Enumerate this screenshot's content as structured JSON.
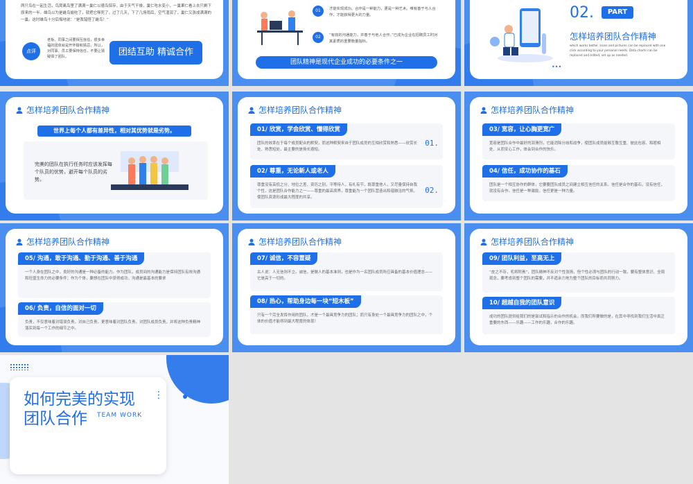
{
  "s1": {
    "text": "两只鸟在一起生活，鸟窝离鸟里了满满一巢仁以德鸟保存，由于天气干燥，巢仁吃水变小，一巢果仁看上去只剩下原来的一半。雄鸟以为是雌鸟偷吃了，就把它啄死了，过了几天，下了几场雨后，空气湿润了，巢仁又涨成满满的一巢。这时雄鸟十分后悔地说：“是我错怪了雌鸟！”",
    "comment_badge": "点评",
    "comment": "老板、同事之间要相互信任，很多幸福的团体就是开怀疑和猜忌，所以，对同事、员工要保持信任，不要让猜疑毁了团队。",
    "button": "团结互助 精诚合作"
  },
  "s2": {
    "items": [
      {
        "num": "01",
        "text": "才能实现成功。合作是一种能力，更是一种艺术。唯有善于与人合作，才能获得更大的力量。"
      },
      {
        "num": "02",
        "text": "“有效的沟通能力，并善于与他人合作。”已成为企业在招聘员工时对其素质的重要衡量指标。"
      }
    ],
    "banner": "团队精神是现代企业成功的必要条件之一"
  },
  "s3": {
    "num": "02.",
    "part": "PART",
    "title": "怎样培养团队合作精神",
    "subtitle": "which works better. Icons and pictures can be replaced with one click according to your personal needs. Data charts can be replaced and edited, set up as needed.",
    "dots": "•••"
  },
  "s4": {
    "header": "怎样培养团队合作精神",
    "banner": "世界上每个人都有差异性，相对其优势就是劣势。",
    "text": "完美的团队在执行任务时应该发挥每个队员的优势，避开每个队员的劣势。"
  },
  "s5": {
    "header": "怎样培养团队合作精神",
    "sections": [
      {
        "title": "01/ 欣赏，学会欣赏、懂得欣赏",
        "num": "01.",
        "text": "团队的效率在于每个成员配合的默契，而这种默契来自于团队成员的互相欣赏和熟悉——欣赏长处、熟悉短处，最主要的是扬长避短。"
      },
      {
        "title": "02/ 尊重，无论新人或老人",
        "num": "02.",
        "text": "尊重没有高低之分、地位之差、资历之别，平等待人，有礼有节，既尊重他人，又尽量保持自我个性，这是团队合作能力之一——尊重的最高境界，尊重能为一个团队营造出和谐融洽的气氛，使团队资源形成最大程度的共享。"
      }
    ]
  },
  "s6": {
    "header": "怎样培养团队合作精神",
    "sections": [
      {
        "title": "03/ 宽容，让心胸更宽广",
        "text": "宽容是团队合作中最好的润滑剂，它能消除分歧和战争，使团队成员能够互敬互重、彼此包容、和睦相处、从而安心工作，体会到合作的快乐。"
      },
      {
        "title": "04/ 信任，成功协作的基石",
        "text": "团队是一个相互协作的群体，它要要团队成员之间建立相互信任的关系。信任是合作的基石，没有信任，就没有合作。信任是一种激励，信任更是一种力量。"
      }
    ]
  },
  "s7": {
    "header": "怎样培养团队合作精神",
    "sections": [
      {
        "title": "05/ 沟通，敢于沟通、勤于沟通、善于沟通",
        "text": "一个人身在团队之中，良好的沟通是一种必备的能力。作为团队，成员间的沟通能力是保持团队有效沟通和旺盛生命力的必要条件；作为个体，要想在团队中获得成功，沟通是最基本的要求"
      },
      {
        "title": "06/ 负责，自信的面对一切",
        "text": "负责，不仅意味着对错误负责，对自己负责，更意味着对团队负责，对团队成员负责，并将这种负责精神落实到每一个工作的细节之中。"
      }
    ]
  },
  "s8": {
    "header": "怎样培养团队合作精神",
    "sections": [
      {
        "title": "07/ 诚信，不容置疑",
        "text": "古人说：人无信则不立。诚信，是做人的基本准则，也是作为一名团队成员所应具备的基本价值理念——它是高于一切的。"
      },
      {
        "title": "08/ 热心，帮助身边每一块“短木板”",
        "text": "只有一个完全发挥作用的团队，才是一个最具竞争力的团队；而只有身处一个最具竞争力的团队之中，个体的价值才能得到最大程度的体现！"
      }
    ]
  },
  "s9": {
    "header": "怎样培养团队合作精神",
    "sections": [
      {
        "title": "09/ 团队利益，至高无上",
        "text": "“皮之不存，毛将附焉”，团队精神不反对个性张扬，但个性必须与团队的行动一致，要有整体意识、全局观念，要考虑到整个团队的需要，并不遗余力地为整个团队的目标而共同努力。"
      },
      {
        "title": "10/ 超越自我的团队意识",
        "text": "成功的团队提供给我们的是尝试和指示的合作的机会，而我们所要做的是，在其中寻找到我们生活中真正重要的东西——乐趣——工作的乐趣，合作的乐趣。"
      }
    ]
  },
  "s10": {
    "title_line1": "如何完美的实现",
    "title_line2": "团队合作",
    "en": "TEAM WORK",
    "dots": "⋮"
  },
  "colors": {
    "primary": "#1f6fe8",
    "slide_bg": "#4a8ef0",
    "section_bg": "#f4f6fa"
  }
}
